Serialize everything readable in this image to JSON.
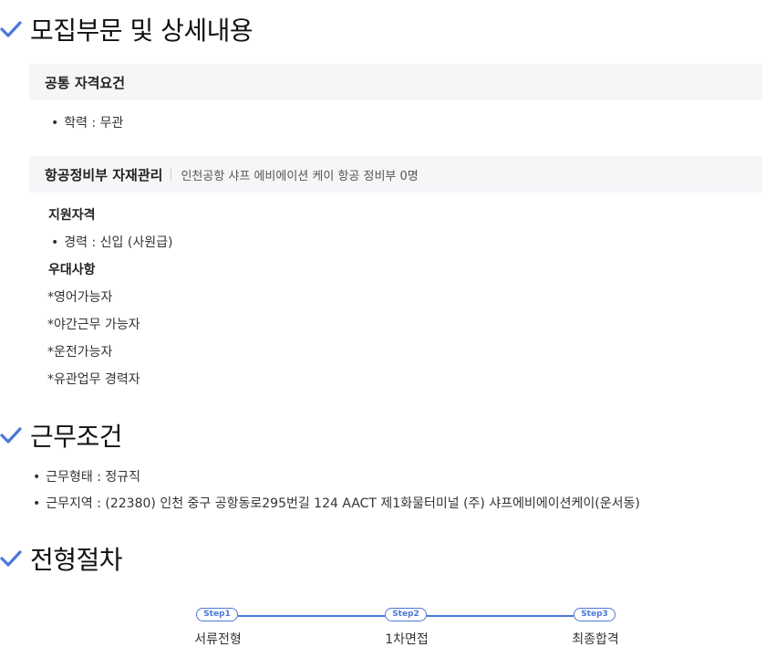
{
  "colors": {
    "accent": "#4a78d6",
    "box_bg": "#f5f6f8"
  },
  "sections": {
    "recruit": {
      "title": "모집부문 및 상세내용"
    },
    "conditions": {
      "title": "근무조건"
    },
    "process": {
      "title": "전형절차"
    }
  },
  "common": {
    "heading": "공통 자격요건",
    "items": [
      "학력 : 무관"
    ]
  },
  "position": {
    "name": "항공정비부 자재관리",
    "detail": "인천공항 샤프 에비에이션 케이 항공 정비부 0명",
    "qual_label": "지원자격",
    "qual_items": [
      "경력 : 신입 (사원급)"
    ],
    "pref_label": "우대사항",
    "pref_items": [
      "*영어가능자",
      "*야간근무 가능자",
      "*운전가능자",
      "*유관업무 경력자"
    ]
  },
  "work": {
    "items": [
      "근무형태 : 정규직",
      "근무지역 : (22380) 인천 중구 공항동로295번길 124 AACT 제1화물터미널 (주) 샤프에비에이션케이(운서동)"
    ]
  },
  "steps": [
    {
      "pill": "Step1",
      "label": "서류전형"
    },
    {
      "pill": "Step2",
      "label": "1차면접"
    },
    {
      "pill": "Step3",
      "label": "최종합격"
    }
  ]
}
